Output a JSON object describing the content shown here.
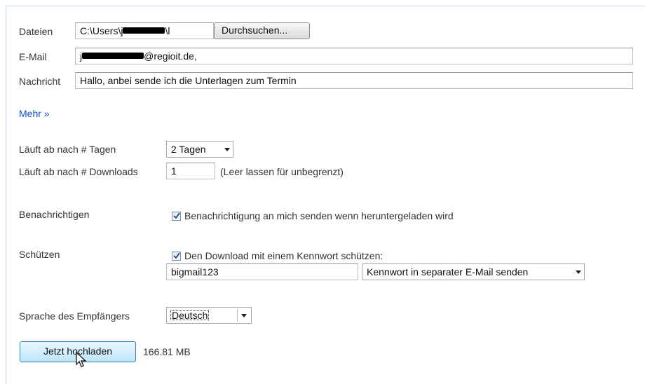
{
  "form": {
    "files": {
      "label": "Dateien",
      "value_prefix": "C:\\Users\\j",
      "value_suffix": "\\l",
      "browse_label": "Durchsuchen..."
    },
    "email": {
      "label": "E-Mail",
      "value_prefix": "j",
      "value_suffix": "@regioit.de,"
    },
    "message": {
      "label": "Nachricht",
      "value": "Hallo, anbei sende ich die Unterlagen zum Termin"
    },
    "more_link": "Mehr »",
    "expires_days": {
      "label": "Läuft ab nach # Tagen",
      "selected": "2 Tagen"
    },
    "expires_downloads": {
      "label": "Läuft ab nach # Downloads",
      "value": "1",
      "hint": "(Leer lassen für unbegrenzt)"
    },
    "notify": {
      "label": "Benachrichtigen",
      "checkbox_label": "Benachrichtigung an mich senden wenn heruntergeladen wird",
      "checked": true
    },
    "protect": {
      "label": "Schützen",
      "checkbox_label": "Den Download mit einem Kennwort schützen:",
      "checked": true,
      "password_value": "bigmail123",
      "delivery_selected": "Kennwort in separater E-Mail senden"
    },
    "language": {
      "label": "Sprache des Empfängers",
      "selected": "Deutsch"
    },
    "upload_button": "Jetzt hochladen",
    "total_size": "166.81 MB"
  }
}
